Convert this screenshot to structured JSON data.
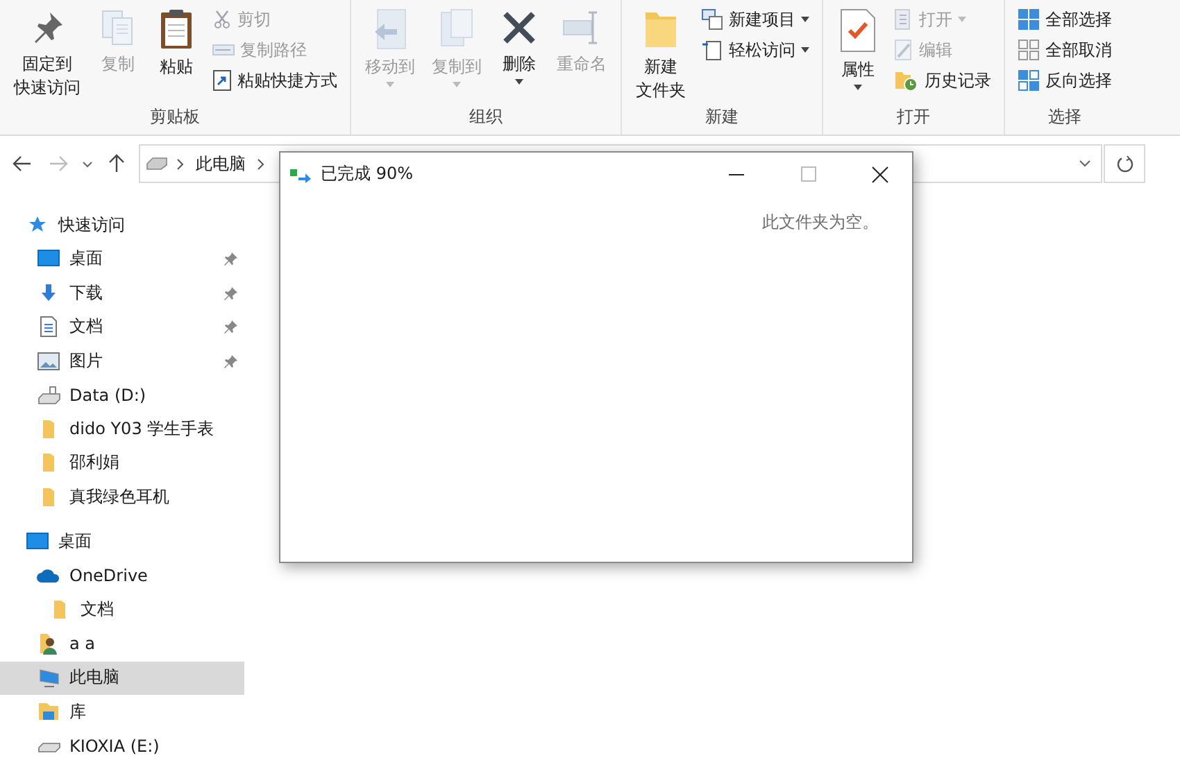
{
  "ribbon": {
    "groups": [
      {
        "label": "剪贴板",
        "items": [
          {
            "kind": "large",
            "lines": [
              "固定到",
              "快速访问"
            ],
            "disabled": false,
            "has_menu": false
          },
          {
            "kind": "large",
            "lines": [
              "复制"
            ],
            "disabled": true,
            "has_menu": false
          },
          {
            "kind": "large",
            "lines": [
              "粘贴"
            ],
            "disabled": false,
            "has_menu": false
          },
          {
            "kind": "small",
            "lines": [
              "剪切"
            ],
            "disabled": true,
            "has_menu": false
          },
          {
            "kind": "small",
            "lines": [
              "复制路径"
            ],
            "disabled": true,
            "has_menu": false
          },
          {
            "kind": "small",
            "lines": [
              "粘贴快捷方式"
            ],
            "disabled": false,
            "has_menu": false
          }
        ]
      },
      {
        "label": "组织",
        "items": [
          {
            "kind": "large",
            "lines": [
              "移动到"
            ],
            "disabled": true,
            "has_menu": true
          },
          {
            "kind": "large",
            "lines": [
              "复制到"
            ],
            "disabled": true,
            "has_menu": true
          },
          {
            "kind": "large",
            "lines": [
              "删除"
            ],
            "disabled": false,
            "has_menu": true
          },
          {
            "kind": "large",
            "lines": [
              "重命名"
            ],
            "disabled": true,
            "has_menu": false
          }
        ]
      },
      {
        "label": "新建",
        "items": [
          {
            "kind": "large",
            "lines": [
              "新建",
              "文件夹"
            ],
            "disabled": false,
            "has_menu": false
          },
          {
            "kind": "small",
            "lines": [
              "新建项目"
            ],
            "disabled": false,
            "has_menu": true
          },
          {
            "kind": "small",
            "lines": [
              "轻松访问"
            ],
            "disabled": false,
            "has_menu": true
          }
        ]
      },
      {
        "label": "打开",
        "items": [
          {
            "kind": "large",
            "lines": [
              "属性"
            ],
            "disabled": false,
            "has_menu": true
          },
          {
            "kind": "small",
            "lines": [
              "打开"
            ],
            "disabled": true,
            "has_menu": true
          },
          {
            "kind": "small",
            "lines": [
              "编辑"
            ],
            "disabled": true,
            "has_menu": false
          },
          {
            "kind": "small",
            "lines": [
              "历史记录"
            ],
            "disabled": false,
            "has_menu": false
          }
        ]
      },
      {
        "label": "选择",
        "items": [
          {
            "kind": "small",
            "lines": [
              "全部选择"
            ],
            "disabled": false,
            "has_menu": false
          },
          {
            "kind": "small",
            "lines": [
              "全部取消"
            ],
            "disabled": false,
            "has_menu": false
          },
          {
            "kind": "small",
            "lines": [
              "反向选择"
            ],
            "disabled": false,
            "has_menu": false
          }
        ]
      }
    ]
  },
  "address_bar": {
    "back_disabled": false,
    "forward_disabled": true,
    "breadcrumbs": [
      "此电脑"
    ]
  },
  "navigation_pane": {
    "sections": [
      {
        "label": "快速访问",
        "selected": false,
        "children": [
          {
            "label": "桌面",
            "pinned": true,
            "selected": false
          },
          {
            "label": "下载",
            "pinned": true,
            "selected": false
          },
          {
            "label": "文档",
            "pinned": true,
            "selected": false
          },
          {
            "label": "图片",
            "pinned": true,
            "selected": false
          },
          {
            "label": "Data (D:)",
            "pinned": false,
            "selected": false
          },
          {
            "label": "dido Y03 学生手表",
            "pinned": false,
            "selected": false
          },
          {
            "label": "邵利娟",
            "pinned": false,
            "selected": false
          },
          {
            "label": "真我绿色耳机",
            "pinned": false,
            "selected": false
          }
        ]
      },
      {
        "label": "桌面",
        "selected": false,
        "children": [
          {
            "label": "OneDrive",
            "pinned": false,
            "selected": false,
            "children": [
              {
                "label": "文档",
                "pinned": false,
                "selected": false
              }
            ]
          },
          {
            "label": "a a",
            "pinned": false,
            "selected": false
          },
          {
            "label": "此电脑",
            "pinned": false,
            "selected": true
          },
          {
            "label": "库",
            "pinned": false,
            "selected": false
          },
          {
            "label": "KIOXIA (E:)",
            "pinned": false,
            "selected": false
          }
        ]
      }
    ]
  },
  "dialog": {
    "title": "已完成 90%",
    "message": "此文件夹为空。"
  }
}
